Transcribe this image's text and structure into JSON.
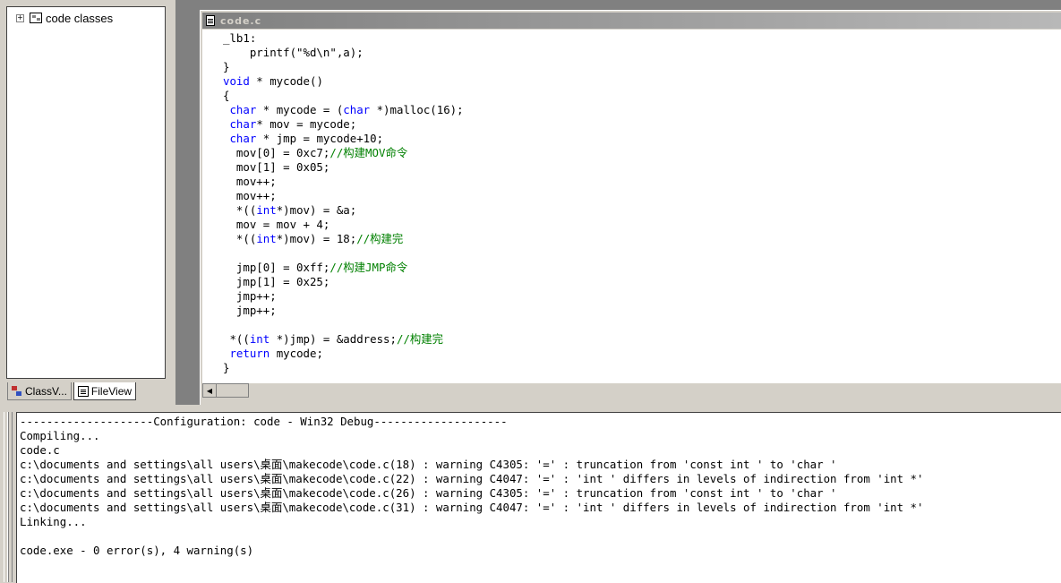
{
  "workspace": {
    "tree_root_label": "code classes",
    "tree_expander": "+",
    "tabs": [
      {
        "label": "ClassV...",
        "icon": "classview-icon"
      },
      {
        "label": "FileView",
        "icon": "fileview-icon"
      }
    ]
  },
  "editor": {
    "title": "code.c",
    "lines": [
      [
        {
          "t": "_lb1:",
          "c": ""
        }
      ],
      [
        {
          "t": "    printf(\"%d\\n\",a);",
          "c": ""
        }
      ],
      [
        {
          "t": "}",
          "c": ""
        }
      ],
      [
        {
          "t": "void",
          "c": "kw"
        },
        {
          "t": " * mycode()",
          "c": ""
        }
      ],
      [
        {
          "t": "{",
          "c": ""
        }
      ],
      [
        {
          "t": " ",
          "c": ""
        },
        {
          "t": "char",
          "c": "kw"
        },
        {
          "t": " * mycode = (",
          "c": ""
        },
        {
          "t": "char",
          "c": "kw"
        },
        {
          "t": " *)malloc(16);",
          "c": ""
        }
      ],
      [
        {
          "t": " ",
          "c": ""
        },
        {
          "t": "char",
          "c": "kw"
        },
        {
          "t": "* mov = mycode;",
          "c": ""
        }
      ],
      [
        {
          "t": " ",
          "c": ""
        },
        {
          "t": "char",
          "c": "kw"
        },
        {
          "t": " * jmp = mycode+10;",
          "c": ""
        }
      ],
      [
        {
          "t": "  mov[0] = 0xc7;",
          "c": ""
        },
        {
          "t": "//构建MOV命令",
          "c": "cm"
        }
      ],
      [
        {
          "t": "  mov[1] = 0x05;",
          "c": ""
        }
      ],
      [
        {
          "t": "  mov++;",
          "c": ""
        }
      ],
      [
        {
          "t": "  mov++;",
          "c": ""
        }
      ],
      [
        {
          "t": "  *((",
          "c": ""
        },
        {
          "t": "int",
          "c": "kw"
        },
        {
          "t": "*)mov) = &a;",
          "c": ""
        }
      ],
      [
        {
          "t": "  mov = mov + 4;",
          "c": ""
        }
      ],
      [
        {
          "t": "  *((",
          "c": ""
        },
        {
          "t": "int",
          "c": "kw"
        },
        {
          "t": "*)mov) = 18;",
          "c": ""
        },
        {
          "t": "//构建完",
          "c": "cm"
        }
      ],
      [
        {
          "t": "",
          "c": ""
        }
      ],
      [
        {
          "t": "  jmp[0] = 0xff;",
          "c": ""
        },
        {
          "t": "//构建JMP命令",
          "c": "cm"
        }
      ],
      [
        {
          "t": "  jmp[1] = 0x25;",
          "c": ""
        }
      ],
      [
        {
          "t": "  jmp++;",
          "c": ""
        }
      ],
      [
        {
          "t": "  jmp++;",
          "c": ""
        }
      ],
      [
        {
          "t": "",
          "c": ""
        }
      ],
      [
        {
          "t": " *((",
          "c": ""
        },
        {
          "t": "int",
          "c": "kw"
        },
        {
          "t": " *)jmp) = &address;",
          "c": ""
        },
        {
          "t": "//构建完",
          "c": "cm"
        }
      ],
      [
        {
          "t": " ",
          "c": ""
        },
        {
          "t": "return",
          "c": "kw"
        },
        {
          "t": " mycode;",
          "c": ""
        }
      ],
      [
        {
          "t": "}",
          "c": ""
        }
      ]
    ]
  },
  "output": {
    "lines": [
      "--------------------Configuration: code - Win32 Debug--------------------",
      "Compiling...",
      "code.c",
      "c:\\documents and settings\\all users\\桌面\\makecode\\code.c(18) : warning C4305: '=' : truncation from 'const int ' to 'char '",
      "c:\\documents and settings\\all users\\桌面\\makecode\\code.c(22) : warning C4047: '=' : 'int ' differs in levels of indirection from 'int *'",
      "c:\\documents and settings\\all users\\桌面\\makecode\\code.c(26) : warning C4305: '=' : truncation from 'const int ' to 'char '",
      "c:\\documents and settings\\all users\\桌面\\makecode\\code.c(31) : warning C4047: '=' : 'int ' differs in levels of indirection from 'int *'",
      "Linking...",
      "",
      "code.exe - 0 error(s), 4 warning(s)"
    ]
  },
  "colors": {
    "keyword": "#0000ff",
    "comment": "#008000",
    "chrome": "#d4d0c8",
    "mdi_background": "#808080"
  }
}
